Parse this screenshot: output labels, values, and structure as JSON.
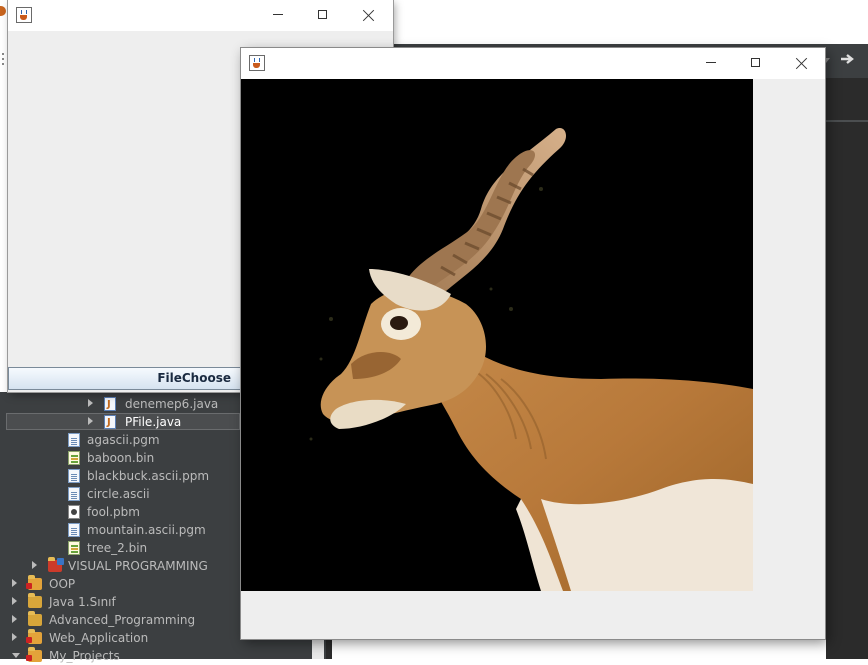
{
  "ide": {
    "tree_items": [
      {
        "label": "denemep6.java",
        "icon": "java-file-icon",
        "expandable": true,
        "selected": false
      },
      {
        "label": "PFile.java",
        "icon": "java-file-icon",
        "expandable": true,
        "selected": true
      },
      {
        "label": "agascii.pgm",
        "icon": "text-file-icon",
        "expandable": false,
        "selected": false
      },
      {
        "label": "baboon.bin",
        "icon": "binary-file-icon",
        "expandable": false,
        "selected": false
      },
      {
        "label": "blackbuck.ascii.ppm",
        "icon": "text-file-icon",
        "expandable": false,
        "selected": false
      },
      {
        "label": "circle.ascii",
        "icon": "text-file-icon",
        "expandable": false,
        "selected": false
      },
      {
        "label": "fool.pbm",
        "icon": "image-file-icon",
        "expandable": false,
        "selected": false
      },
      {
        "label": "mountain.ascii.pgm",
        "icon": "text-file-icon",
        "expandable": false,
        "selected": false
      },
      {
        "label": "tree_2.bin",
        "icon": "binary-file-icon",
        "expandable": false,
        "selected": false
      },
      {
        "label": "VISUAL PROGRAMMING",
        "icon": "project-icon",
        "expandable": true,
        "selected": false
      },
      {
        "label": "OOP",
        "icon": "project-icon",
        "expandable": true,
        "selected": false
      },
      {
        "label": "Java 1.Sınıf",
        "icon": "project-icon",
        "expandable": true,
        "selected": false
      },
      {
        "label": "Advanced_Programming",
        "icon": "project-icon",
        "expandable": true,
        "selected": false
      },
      {
        "label": "Web_Application",
        "icon": "project-icon",
        "expandable": true,
        "selected": false
      },
      {
        "label": "My_Projects",
        "icon": "project-icon",
        "expandable": true,
        "selected": false
      }
    ]
  },
  "window1": {
    "title": "",
    "button_label": "FileChoose"
  },
  "window2": {
    "title": "",
    "image_subject": "blackbuck"
  },
  "colors": {
    "ide_dark": "#3c3f41",
    "editor_dark": "#2b2b2b",
    "button_text": "#1a2a40"
  }
}
